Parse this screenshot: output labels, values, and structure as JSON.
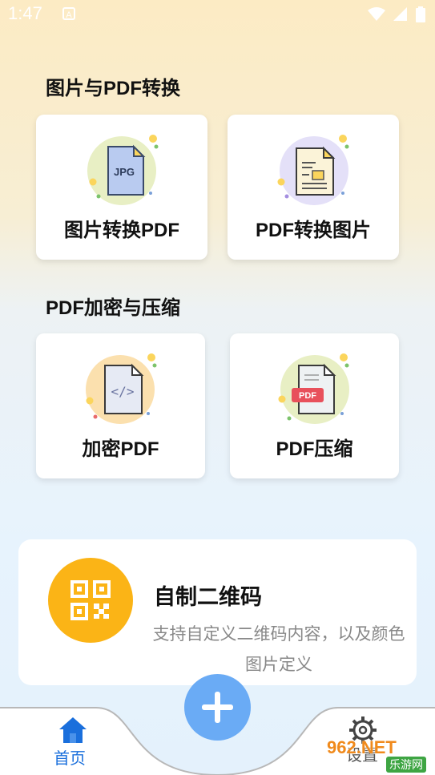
{
  "status": {
    "time": "1:47",
    "notif_icon": "A"
  },
  "section1": {
    "title": "图片与PDF转换"
  },
  "cards": {
    "img_to_pdf": {
      "label": "图片转换PDF",
      "icon_text": "JPG"
    },
    "pdf_to_img": {
      "label": "PDF转换图片"
    },
    "encrypt": {
      "label": "加密PDF",
      "icon_text": "</>"
    },
    "compress": {
      "label": "PDF压缩",
      "icon_text": "PDF"
    }
  },
  "section2": {
    "title": "PDF加密与压缩"
  },
  "qr": {
    "title": "自制二维码",
    "desc": "支持自定义二维码内容，以及颜色图片定义"
  },
  "nav": {
    "home_label": "首页",
    "settings_label": "设置"
  },
  "watermark": {
    "text": "962.NET",
    "sub": "乐游网"
  },
  "colors": {
    "qr_accent": "#fbb416",
    "nav_active": "#1a6fdc",
    "fab": "#6aabf5"
  }
}
